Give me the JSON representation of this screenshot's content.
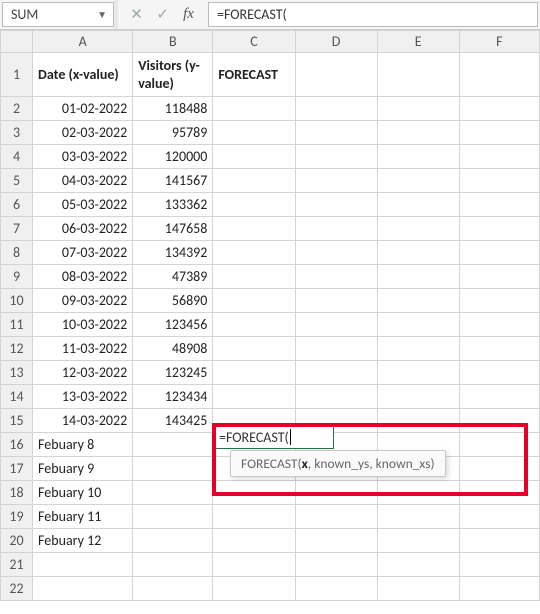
{
  "namebox": {
    "value": "SUM"
  },
  "fx": {
    "cancel_glyph": "✕",
    "enter_glyph": "✓",
    "fx_label": "fx"
  },
  "formula_bar": {
    "value": "=FORECAST("
  },
  "columns": [
    "A",
    "B",
    "C",
    "D",
    "E",
    "F"
  ],
  "row_numbers": [
    "1",
    "2",
    "3",
    "4",
    "5",
    "6",
    "7",
    "8",
    "9",
    "10",
    "11",
    "12",
    "13",
    "14",
    "15",
    "16",
    "17",
    "18",
    "19",
    "20",
    "21",
    "22"
  ],
  "headers": {
    "A": "Date (x-value)",
    "B": "Visitors (y-value)",
    "C": "FORECAST"
  },
  "rows": [
    {
      "A": "01-02-2022",
      "B": "118488"
    },
    {
      "A": "02-03-2022",
      "B": "95789"
    },
    {
      "A": "03-03-2022",
      "B": "120000"
    },
    {
      "A": "04-03-2022",
      "B": "141567"
    },
    {
      "A": "05-03-2022",
      "B": "133362"
    },
    {
      "A": "06-03-2022",
      "B": "147658"
    },
    {
      "A": "07-03-2022",
      "B": "134392"
    },
    {
      "A": "08-03-2022",
      "B": "47389"
    },
    {
      "A": "09-03-2022",
      "B": "56890"
    },
    {
      "A": "10-03-2022",
      "B": "123456"
    },
    {
      "A": "11-03-2022",
      "B": "48908"
    },
    {
      "A": "12-03-2022",
      "B": "123245"
    },
    {
      "A": "13-03-2022",
      "B": "123434"
    },
    {
      "A": "14-03-2022",
      "B": "143425"
    },
    {
      "A": "Febuary 8",
      "B": ""
    },
    {
      "A": "Febuary 9",
      "B": ""
    },
    {
      "A": "Febuary 10",
      "B": ""
    },
    {
      "A": "Febuary 11",
      "B": ""
    },
    {
      "A": "Febuary 12",
      "B": ""
    },
    {
      "A": "",
      "B": ""
    },
    {
      "A": "",
      "B": ""
    }
  ],
  "active_cell": {
    "formula": "=FORECAST("
  },
  "tooltip": {
    "fn": "FORECAST",
    "args_display_pre": "(",
    "arg_bold": "x",
    "args_display_post": ", known_ys, known_xs)"
  }
}
